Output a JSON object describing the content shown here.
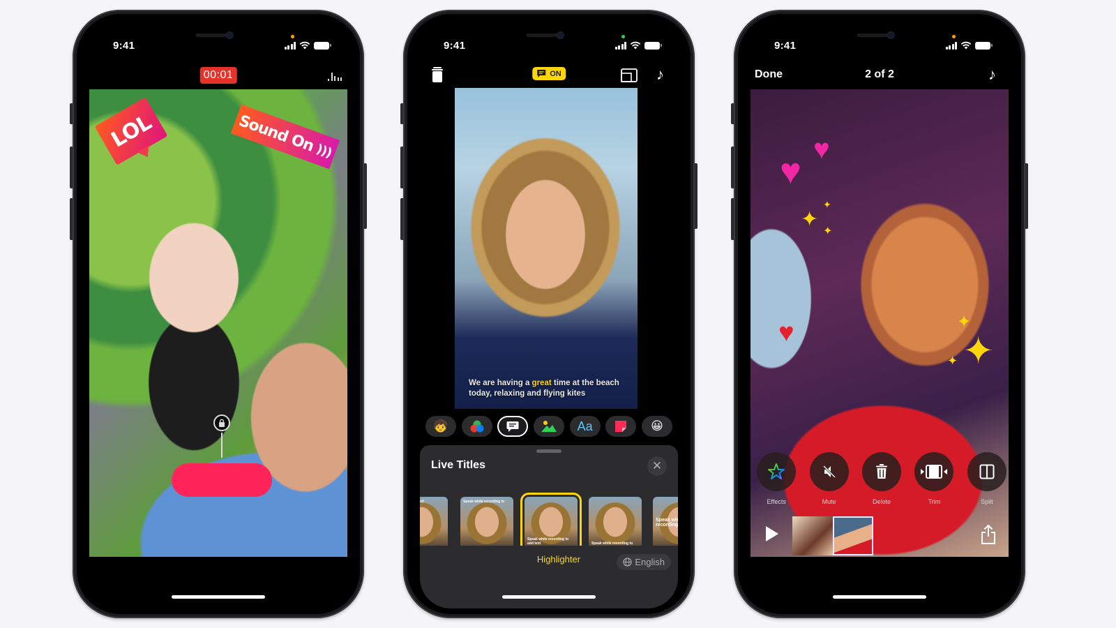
{
  "colors": {
    "background": "#f5f5f7",
    "record_red": "#e5332a",
    "record_button_pink": "#ff2459",
    "live_titles_yellow": "#ffd60a",
    "sheet_bg": "#2c2c2e"
  },
  "phones": [
    {
      "id": "recording",
      "status": {
        "time": "9:41",
        "privacy_indicator": "orange"
      },
      "top_bar": {
        "timer": "00:01",
        "audio_meter_icon": "audio-level-icon"
      },
      "stickers": [
        {
          "text": "LOL"
        },
        {
          "text": "Sound On",
          "icon": "sound-waves-icon"
        }
      ],
      "controls": {
        "lock_icon": "lock-icon",
        "record_button": "record-button"
      }
    },
    {
      "id": "live-titles",
      "status": {
        "time": "9:41",
        "privacy_indicator": "green"
      },
      "top_bar": {
        "delete_icon": "trash-icon",
        "titles_toggle_label": "ON",
        "layout_icon": "aspect-icon",
        "music_icon": "music-note-icon"
      },
      "caption": {
        "before": "We are having a ",
        "highlight": "great",
        "after": " time at the beach today, relaxing and flying kites"
      },
      "tools": [
        {
          "name": "memoji",
          "glyph": "🧒"
        },
        {
          "name": "filters",
          "glyph": "●"
        },
        {
          "name": "live-titles",
          "glyph": "💬",
          "active": true
        },
        {
          "name": "posters",
          "glyph": "⛰"
        },
        {
          "name": "text",
          "glyph": "Aa"
        },
        {
          "name": "stickers",
          "glyph": "▰"
        },
        {
          "name": "emoji",
          "glyph": "😀"
        }
      ],
      "sheet": {
        "title": "Live Titles",
        "close_label": "✕",
        "styles": [
          {
            "caption": "ding is add text!"
          },
          {
            "caption": "Speak while recording to"
          },
          {
            "caption": "Speak while recording to add text",
            "selected": true
          },
          {
            "caption": "Speak while recording to"
          },
          {
            "caption": "Speak while recording to"
          }
        ],
        "selected_style_label": "Highlighter",
        "language_label": "English"
      }
    },
    {
      "id": "edit-clip",
      "status": {
        "time": "9:41",
        "privacy_indicator": "orange"
      },
      "top_bar": {
        "done_label": "Done",
        "clip_position": "2 of 2",
        "music_icon": "music-note-icon"
      },
      "actions": [
        {
          "label": "Effects",
          "icon": "star-icon"
        },
        {
          "label": "Mute",
          "icon": "speaker-slash-icon"
        },
        {
          "label": "Delete",
          "icon": "trash-icon"
        },
        {
          "label": "Trim",
          "icon": "trim-icon"
        },
        {
          "label": "Split",
          "icon": "split-icon"
        }
      ],
      "timeline": {
        "clips": 2,
        "selected_clip": 2
      }
    }
  ]
}
